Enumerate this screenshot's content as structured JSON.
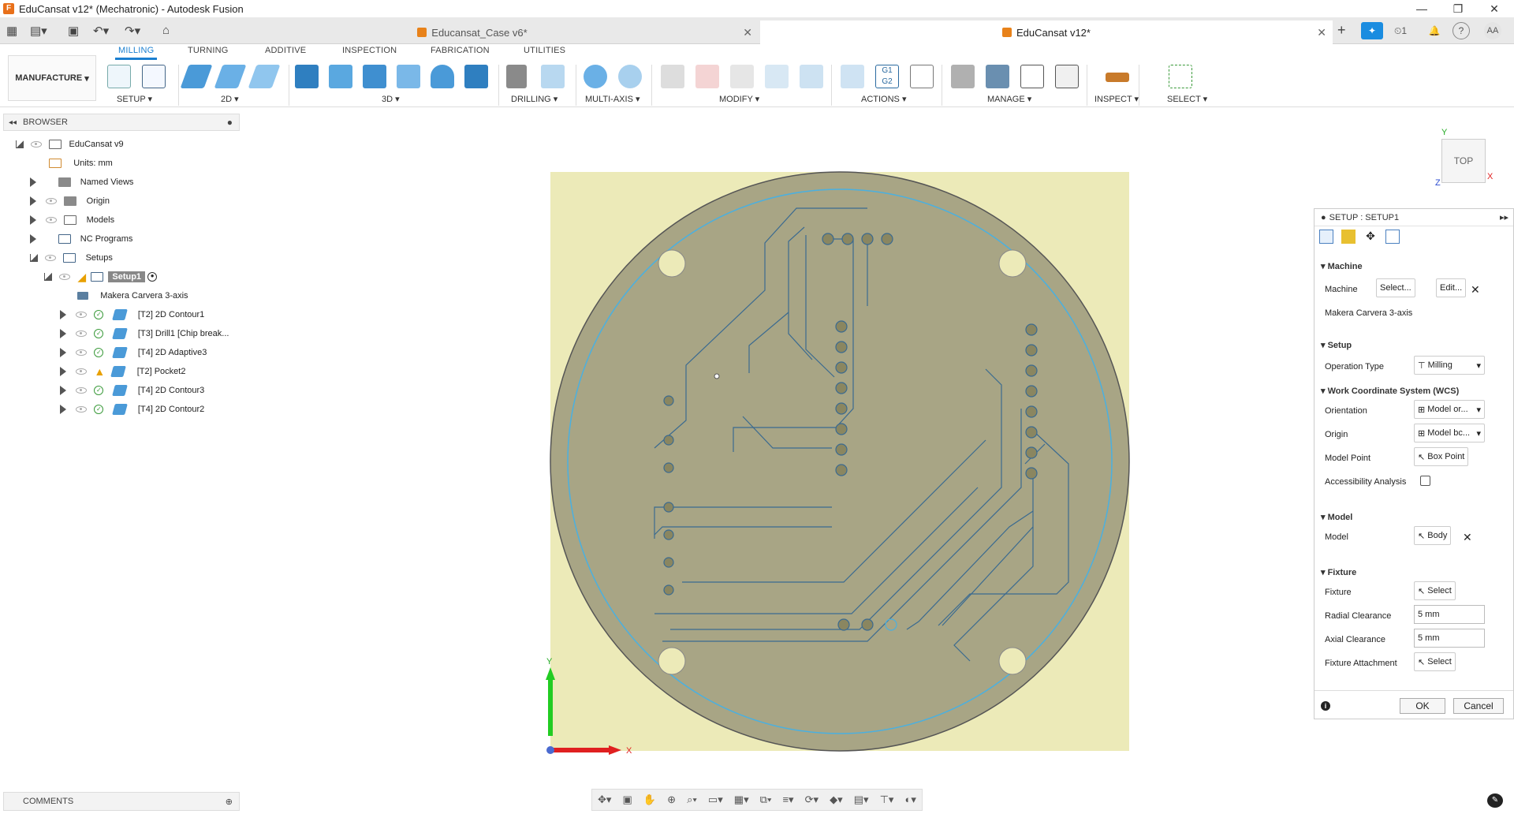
{
  "window": {
    "title": "EduCansat v12* (Mechatronic) - Autodesk Fusion"
  },
  "tabs": [
    {
      "label": "Educansat_Case v6*"
    },
    {
      "label": "EduCansat v12*"
    }
  ],
  "right_toolbar": {
    "jobs_count": "1",
    "user_initials": "AA"
  },
  "ribbon": {
    "workspace": "MANUFACTURE",
    "tabs": [
      "MILLING",
      "TURNING",
      "ADDITIVE",
      "INSPECTION",
      "FABRICATION",
      "UTILITIES"
    ],
    "active_tab": "MILLING",
    "groups": [
      "SETUP",
      "2D",
      "3D",
      "DRILLING",
      "MULTI-AXIS",
      "MODIFY",
      "ACTIONS",
      "MANAGE",
      "INSPECT",
      "SELECT"
    ]
  },
  "browser": {
    "title": "BROWSER",
    "root": "EduCansat v9",
    "units": "Units: mm",
    "items": [
      "Named Views",
      "Origin",
      "Models",
      "NC Programs",
      "Setups"
    ],
    "setup": "Setup1",
    "machine": "Makera Carvera 3-axis",
    "operations": [
      {
        "label": "[T2] 2D Contour1",
        "status": "ok"
      },
      {
        "label": "[T3] Drill1 [Chip break...",
        "status": "ok"
      },
      {
        "label": "[T4] 2D Adaptive3",
        "status": "ok"
      },
      {
        "label": "[T2] Pocket2",
        "status": "warn"
      },
      {
        "label": "[T4] 2D Contour3",
        "status": "ok"
      },
      {
        "label": "[T4] 2D Contour2",
        "status": "ok"
      }
    ]
  },
  "comments": {
    "label": "COMMENTS"
  },
  "viewcube": {
    "label": "TOP",
    "axis_y": "Y",
    "axis_x": "X",
    "axis_z": "Z"
  },
  "triad": {
    "y": "Y",
    "x": "X"
  },
  "panel": {
    "title": "SETUP : SETUP1",
    "machine_section": "Machine",
    "machine_label": "Machine",
    "machine_select": "Select...",
    "machine_edit": "Edit...",
    "machine_name": "Makera Carvera 3-axis",
    "setup_section": "Setup",
    "operation_type_label": "Operation Type",
    "operation_type_value": "Milling",
    "wcs_section": "Work Coordinate System (WCS)",
    "orientation_label": "Orientation",
    "orientation_value": "Model or...",
    "origin_label": "Origin",
    "origin_value": "Model bc...",
    "model_point_label": "Model Point",
    "model_point_value": "Box Point",
    "accessibility_label": "Accessibility Analysis",
    "model_section": "Model",
    "model_label": "Model",
    "model_value": "Body",
    "fixture_section": "Fixture",
    "fixture_label": "Fixture",
    "fixture_value": "Select",
    "radial_label": "Radial Clearance",
    "radial_value": "5 mm",
    "axial_label": "Axial Clearance",
    "axial_value": "5 mm",
    "attachment_label": "Fixture Attachment",
    "attachment_value": "Select",
    "ok": "OK",
    "cancel": "Cancel"
  }
}
